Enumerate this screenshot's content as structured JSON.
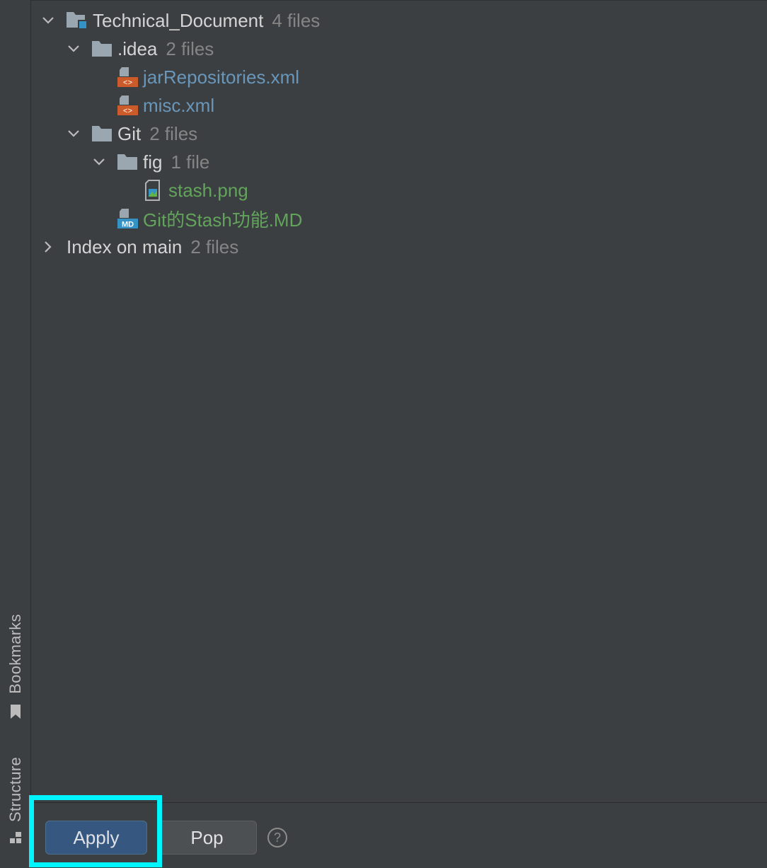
{
  "sidebar": {
    "bookmarks_label": "Bookmarks",
    "structure_label": "Structure"
  },
  "tree": {
    "root": {
      "name": "Technical_Document",
      "count": "4 files"
    },
    "idea": {
      "name": ".idea",
      "count": "2 files"
    },
    "jar": {
      "name": "jarRepositories.xml"
    },
    "misc": {
      "name": "misc.xml"
    },
    "git": {
      "name": "Git",
      "count": "2 files"
    },
    "fig": {
      "name": "fig",
      "count": "1 file"
    },
    "stash": {
      "name": "stash.png"
    },
    "md": {
      "name": "Git的Stash功能.MD"
    },
    "index": {
      "name": "Index on main",
      "count": "2 files"
    }
  },
  "buttons": {
    "apply": "Apply",
    "pop": "Pop",
    "help": "?"
  },
  "colors": {
    "xml_icon": "#cc5b2b",
    "md_icon": "#3592c4",
    "folder": "#9aa7b0",
    "highlight": "#00f5ff"
  }
}
